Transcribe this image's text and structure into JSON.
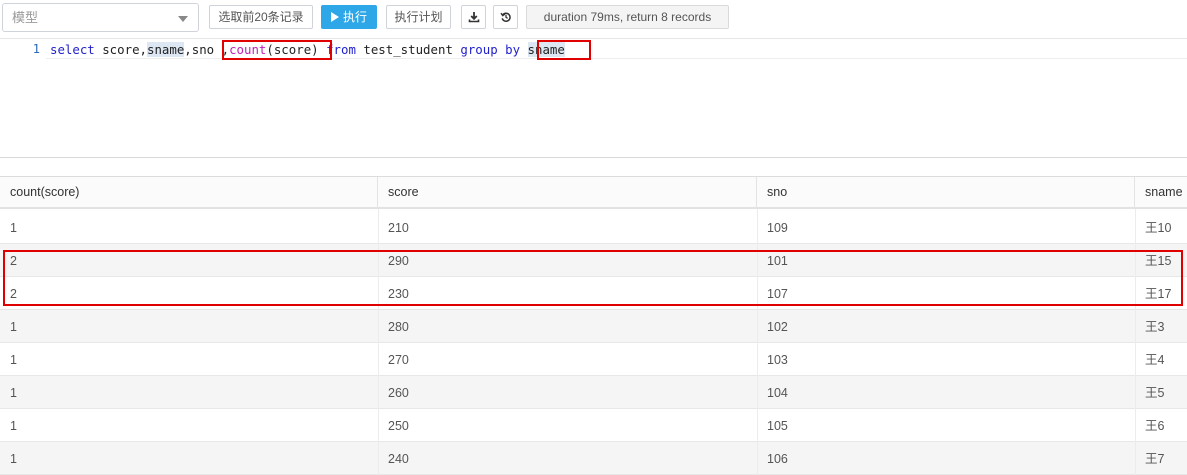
{
  "toolbar": {
    "model_placeholder": "模型",
    "select_top20_label": "选取前20条记录",
    "run_label": "执行",
    "plan_label": "执行计划",
    "download_icon": "download-icon",
    "history_icon": "history-icon",
    "status_text": "duration 79ms, return 8 records"
  },
  "editor": {
    "line_number": "1",
    "tokens": {
      "select": "select",
      "cols": " score,",
      "sname": "sname",
      "cols2": ",sno",
      "comma": ",",
      "count": "count",
      "count_arg": "(score)",
      "from": " from",
      "table": " test_student",
      "group": " group",
      "by": " by",
      "group_col": "sname"
    }
  },
  "results": {
    "columns": [
      "count(score)",
      "score",
      "sno",
      "sname"
    ],
    "rows": [
      [
        "1",
        "210",
        "109",
        "王10"
      ],
      [
        "2",
        "290",
        "101",
        "王15"
      ],
      [
        "2",
        "230",
        "107",
        "王17"
      ],
      [
        "1",
        "280",
        "102",
        "王3"
      ],
      [
        "1",
        "270",
        "103",
        "王4"
      ],
      [
        "1",
        "260",
        "104",
        "王5"
      ],
      [
        "1",
        "250",
        "105",
        "王6"
      ],
      [
        "1",
        "240",
        "106",
        "王7"
      ]
    ]
  },
  "colors": {
    "run_button": "#2ea7e8",
    "annotation_red": "#e00000",
    "keyword": "#2222cc",
    "function": "#c020b8"
  }
}
